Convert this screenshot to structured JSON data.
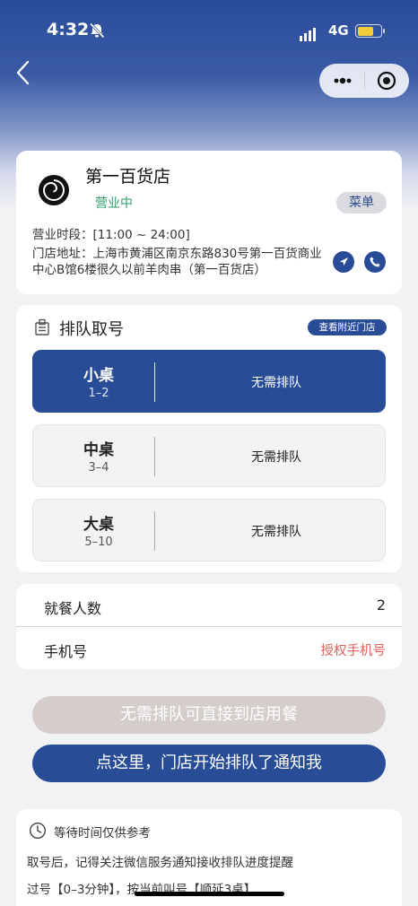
{
  "status_bar": {
    "time": "4:32",
    "network": "4G"
  },
  "store": {
    "name": "第一百货店",
    "status": "营业中",
    "menu_label": "菜单",
    "hours": "营业时段：[11:00 ~ 24:00]",
    "address": "门店地址：上海市黄浦区南京东路830号第一百货商业中心B馆6楼很久以前羊肉串（第一百货店）"
  },
  "queue": {
    "title": "排队取号",
    "nearby_label": "查看附近门店",
    "tables": [
      {
        "name": "小桌",
        "size": "1–2",
        "status": "无需排队",
        "selected": true
      },
      {
        "name": "中桌",
        "size": "3–4",
        "status": "无需排队",
        "selected": false
      },
      {
        "name": "大桌",
        "size": "5–10",
        "status": "无需排队",
        "selected": false
      }
    ]
  },
  "form": {
    "diners_label": "就餐人数",
    "diners_value": "2",
    "phone_label": "手机号",
    "phone_action": "授权手机号"
  },
  "actions": {
    "direct": "无需排队可直接到店用餐",
    "notify": "点这里，门店开始排队了通知我"
  },
  "notes": {
    "title": "等待时间仅供参考",
    "line1": "取号后，记得关注微信服务通知接收排队进度提醒",
    "line2": "过号【0–3分钟】，按当前叫号【顺延3桌】"
  },
  "colors": {
    "primary": "#284d96",
    "open_status": "#2f9e68",
    "auth_link": "#e0625a",
    "disabled_button": "#d4cdcc"
  }
}
